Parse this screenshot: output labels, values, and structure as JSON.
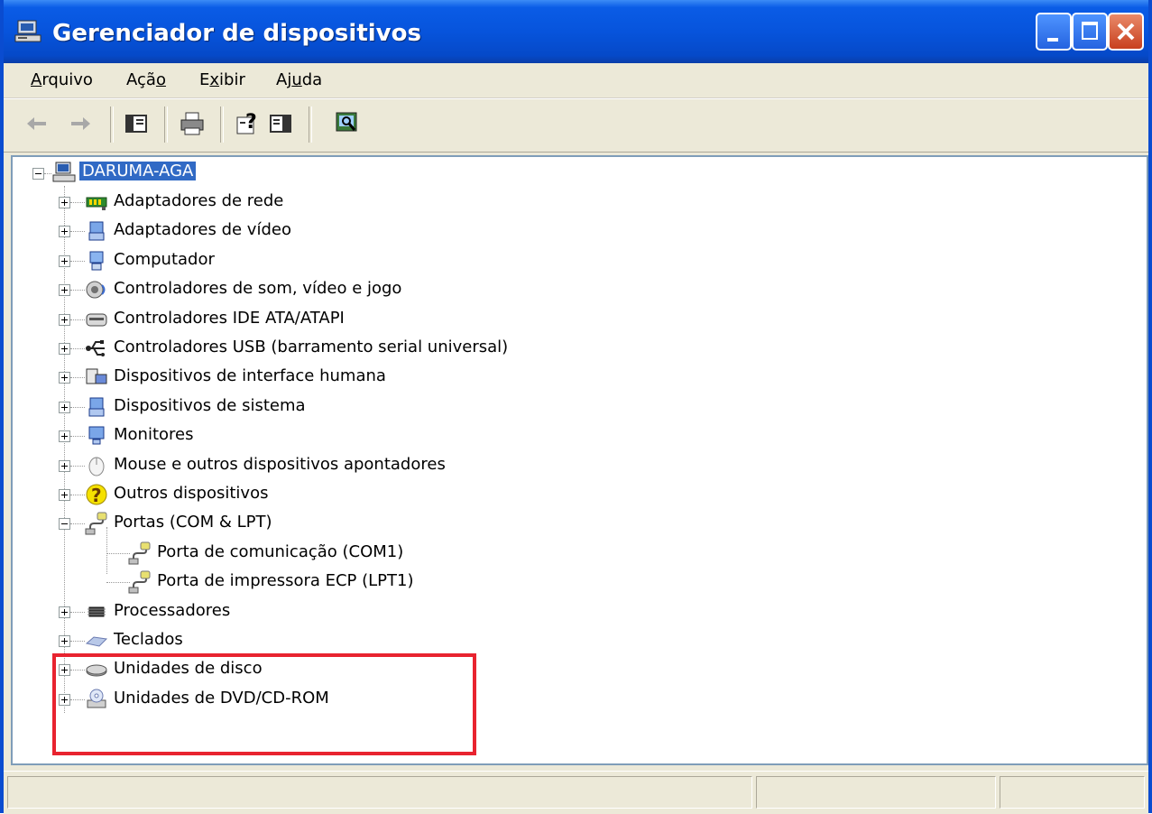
{
  "window": {
    "title": "Gerenciador de dispositivos",
    "title_icon": "computer-icon",
    "controls": [
      "minimize",
      "maximize",
      "close"
    ]
  },
  "menu": {
    "items": [
      {
        "label_pre": "",
        "accel": "A",
        "label_post": "rquivo"
      },
      {
        "label_pre": "Açã",
        "accel": "o",
        "label_post": ""
      },
      {
        "label_pre": "E",
        "accel": "x",
        "label_post": "ibir"
      },
      {
        "label_pre": "Aj",
        "accel": "u",
        "label_post": "da"
      }
    ]
  },
  "toolbar": {
    "buttons": [
      "back-icon",
      "forward-icon",
      "show-hide-console-tree-icon",
      "print-icon",
      "help-icon",
      "properties-icon",
      "scan-hardware-icon"
    ]
  },
  "tree": {
    "root": {
      "label": "DARUMA-AGA",
      "icon": "computer-icon",
      "selected": true
    },
    "items": [
      {
        "label": "Adaptadores de rede",
        "icon": "network-adapter-icon",
        "expanded": false
      },
      {
        "label": "Adaptadores de vídeo",
        "icon": "display-adapter-icon",
        "expanded": false
      },
      {
        "label": "Computador",
        "icon": "computer-monitor-icon",
        "expanded": false
      },
      {
        "label": "Controladores de som, vídeo e jogo",
        "icon": "sound-icon",
        "expanded": false
      },
      {
        "label": "Controladores IDE ATA/ATAPI",
        "icon": "ide-controller-icon",
        "expanded": false
      },
      {
        "label": "Controladores USB (barramento serial universal)",
        "icon": "usb-icon",
        "expanded": false
      },
      {
        "label": "Dispositivos de interface humana",
        "icon": "hid-icon",
        "expanded": false
      },
      {
        "label": "Dispositivos de sistema",
        "icon": "system-device-icon",
        "expanded": false
      },
      {
        "label": "Monitores",
        "icon": "monitor-icon",
        "expanded": false
      },
      {
        "label": "Mouse e outros dispositivos apontadores",
        "icon": "mouse-icon",
        "expanded": false
      },
      {
        "label": "Outros dispositivos",
        "icon": "unknown-device-icon",
        "expanded": false
      },
      {
        "label": "Portas (COM & LPT)",
        "icon": "port-icon",
        "expanded": true,
        "children": [
          {
            "label": "Porta de comunicação (COM1)",
            "icon": "port-icon"
          },
          {
            "label": "Porta de impressora ECP (LPT1)",
            "icon": "port-icon"
          }
        ]
      },
      {
        "label": "Processadores",
        "icon": "processor-icon",
        "expanded": false
      },
      {
        "label": "Teclados",
        "icon": "keyboard-icon",
        "expanded": false
      },
      {
        "label": "Unidades de disco",
        "icon": "disk-drive-icon",
        "expanded": false
      },
      {
        "label": "Unidades de DVD/CD-ROM",
        "icon": "cdrom-icon",
        "expanded": false
      }
    ]
  },
  "annotation": {
    "highlight_color": "#e8232f",
    "target": "Portas (COM & LPT)"
  },
  "colors": {
    "titlebar": "#0754dc",
    "selection": "#316ac5",
    "chrome": "#ece9d8"
  }
}
